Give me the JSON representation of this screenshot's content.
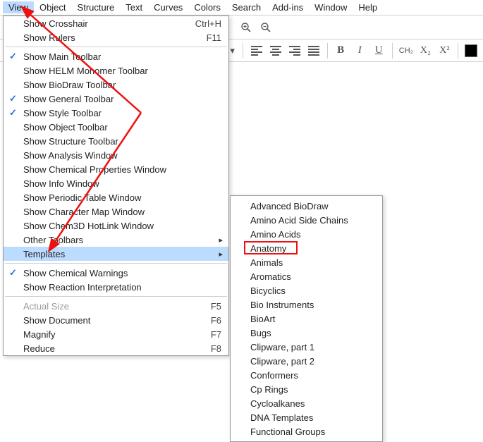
{
  "menubar": {
    "items": [
      {
        "label": "View",
        "active": true
      },
      {
        "label": "Object",
        "active": false
      },
      {
        "label": "Structure",
        "active": false
      },
      {
        "label": "Text",
        "active": false
      },
      {
        "label": "Curves",
        "active": false
      },
      {
        "label": "Colors",
        "active": false
      },
      {
        "label": "Search",
        "active": false
      },
      {
        "label": "Add-ins",
        "active": false
      },
      {
        "label": "Window",
        "active": false
      },
      {
        "label": "Help",
        "active": false
      }
    ]
  },
  "dropdown": {
    "groups": [
      [
        {
          "label": "Show Crosshair",
          "shortcut": "Ctrl+H",
          "checked": false,
          "enabled": true,
          "submenu": false
        },
        {
          "label": "Show Rulers",
          "shortcut": "F11",
          "checked": false,
          "enabled": true,
          "submenu": false
        }
      ],
      [
        {
          "label": "Show Main Toolbar",
          "shortcut": "",
          "checked": true,
          "enabled": true,
          "submenu": false
        },
        {
          "label": "Show HELM Monomer Toolbar",
          "shortcut": "",
          "checked": false,
          "enabled": true,
          "submenu": false
        },
        {
          "label": "Show BioDraw Toolbar",
          "shortcut": "",
          "checked": false,
          "enabled": true,
          "submenu": false
        },
        {
          "label": "Show General Toolbar",
          "shortcut": "",
          "checked": true,
          "enabled": true,
          "submenu": false
        },
        {
          "label": "Show Style Toolbar",
          "shortcut": "",
          "checked": true,
          "enabled": true,
          "submenu": false
        },
        {
          "label": "Show Object Toolbar",
          "shortcut": "",
          "checked": false,
          "enabled": true,
          "submenu": false
        },
        {
          "label": "Show Structure Toolbar",
          "shortcut": "",
          "checked": false,
          "enabled": true,
          "submenu": false
        },
        {
          "label": "Show Analysis Window",
          "shortcut": "",
          "checked": false,
          "enabled": true,
          "submenu": false
        },
        {
          "label": "Show Chemical Properties Window",
          "shortcut": "",
          "checked": false,
          "enabled": true,
          "submenu": false
        },
        {
          "label": "Show Info Window",
          "shortcut": "",
          "checked": false,
          "enabled": true,
          "submenu": false
        },
        {
          "label": "Show Periodic Table Window",
          "shortcut": "",
          "checked": false,
          "enabled": true,
          "submenu": false
        },
        {
          "label": "Show Character Map Window",
          "shortcut": "",
          "checked": false,
          "enabled": true,
          "submenu": false
        },
        {
          "label": "Show Chem3D HotLink Window",
          "shortcut": "",
          "checked": false,
          "enabled": true,
          "submenu": false
        },
        {
          "label": "Other Toolbars",
          "shortcut": "",
          "checked": false,
          "enabled": true,
          "submenu": true
        },
        {
          "label": "Templates",
          "shortcut": "",
          "checked": false,
          "enabled": true,
          "submenu": true,
          "hover": true
        }
      ],
      [
        {
          "label": "Show Chemical Warnings",
          "shortcut": "",
          "checked": true,
          "enabled": true,
          "submenu": false
        },
        {
          "label": "Show Reaction Interpretation",
          "shortcut": "",
          "checked": false,
          "enabled": true,
          "submenu": false
        }
      ],
      [
        {
          "label": "Actual Size",
          "shortcut": "F5",
          "checked": false,
          "enabled": false,
          "submenu": false
        },
        {
          "label": "Show Document",
          "shortcut": "F6",
          "checked": false,
          "enabled": true,
          "submenu": false
        },
        {
          "label": "Magnify",
          "shortcut": "F7",
          "checked": false,
          "enabled": true,
          "submenu": false
        },
        {
          "label": "Reduce",
          "shortcut": "F8",
          "checked": false,
          "enabled": true,
          "submenu": false
        }
      ]
    ]
  },
  "submenu": {
    "items": [
      "Advanced BioDraw",
      "Amino Acid Side Chains",
      "Amino Acids",
      "Anatomy",
      "Animals",
      "Aromatics",
      "Bicyclics",
      "Bio Instruments",
      "BioArt",
      "Bugs",
      "Clipware, part 1",
      "Clipware, part 2",
      "Conformers",
      "Cp Rings",
      "Cycloalkanes",
      "DNA Templates",
      "Functional Groups"
    ],
    "highlighted_index": 3
  },
  "toolbar": {
    "icons": {
      "zoom_in": "zoom-in-icon",
      "zoom_out": "zoom-out-icon",
      "align_left": "align-left-icon",
      "align_center": "align-center-icon",
      "align_right": "align-right-icon",
      "align_justify": "align-justify-icon",
      "bold": "B",
      "italic": "I",
      "underline": "U",
      "chem_formula": "CH₂",
      "subscript": "X₂",
      "superscript": "X²",
      "color_swatch": "#000000"
    }
  }
}
